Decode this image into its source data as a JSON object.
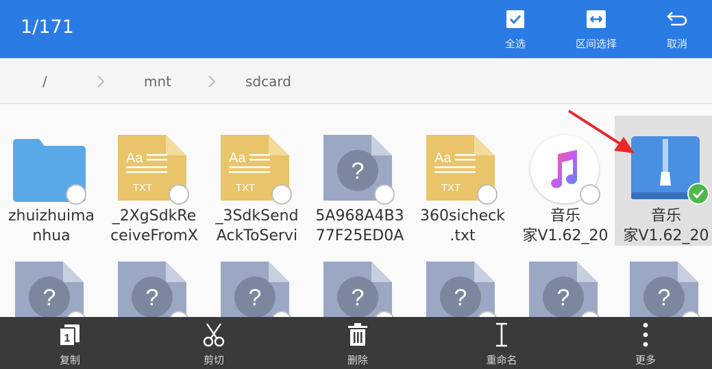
{
  "header": {
    "selection_count": "1/171",
    "actions": [
      {
        "label": "全选",
        "icon": "checkbox-icon"
      },
      {
        "label": "区间选择",
        "icon": "range-select-icon"
      },
      {
        "label": "取消",
        "icon": "undo-icon"
      }
    ],
    "color": "#2b7be4"
  },
  "breadcrumb": [
    "/",
    "mnt",
    "sdcard"
  ],
  "files": [
    {
      "name": "zhuizhuima\nnhua",
      "type": "folder",
      "selected": false
    },
    {
      "name": "_2XgSdkRe\nceiveFromX",
      "type": "txt",
      "badge": "TXT",
      "glyph": "Aa",
      "selected": false
    },
    {
      "name": "_3SdkSend\nAckToServi",
      "type": "txt",
      "badge": "TXT",
      "glyph": "Aa",
      "selected": false
    },
    {
      "name": "5A968A4B3\n77F25ED0A",
      "type": "unknown",
      "glyph": "?",
      "selected": false
    },
    {
      "name": "360sicheck\n.txt",
      "type": "txt",
      "badge": "TXT",
      "glyph": "Aa",
      "selected": false
    },
    {
      "name": "音乐\n家V1.62_20",
      "type": "music",
      "selected": false
    },
    {
      "name": "音乐\n家V1.62_20",
      "type": "archive",
      "selected": true
    },
    {
      "name": "",
      "type": "unknown",
      "glyph": "?",
      "selected": false
    },
    {
      "name": "",
      "type": "unknown",
      "glyph": "?",
      "selected": false
    },
    {
      "name": "",
      "type": "unknown",
      "glyph": "?",
      "selected": false
    },
    {
      "name": "",
      "type": "unknown",
      "glyph": "?",
      "selected": false
    },
    {
      "name": "",
      "type": "unknown",
      "glyph": "?",
      "selected": false
    },
    {
      "name": "",
      "type": "unknown",
      "glyph": "?",
      "selected": false
    },
    {
      "name": "",
      "type": "unknown",
      "glyph": "?",
      "selected": false
    }
  ],
  "bottom_actions": [
    {
      "label": "复制",
      "icon": "copy-icon"
    },
    {
      "label": "剪切",
      "icon": "scissors-icon"
    },
    {
      "label": "删除",
      "icon": "trash-icon"
    },
    {
      "label": "重命名",
      "icon": "rename-icon"
    },
    {
      "label": "更多",
      "icon": "more-vert-icon"
    }
  ],
  "copy_icon_digit": "1",
  "colors": {
    "folder": "#5aa8e8",
    "txt": "#e9c46a",
    "unknown": "#9aa8c4",
    "archive": "#4a90e2",
    "check": "#4cb84c",
    "arrow": "#e8282a"
  }
}
